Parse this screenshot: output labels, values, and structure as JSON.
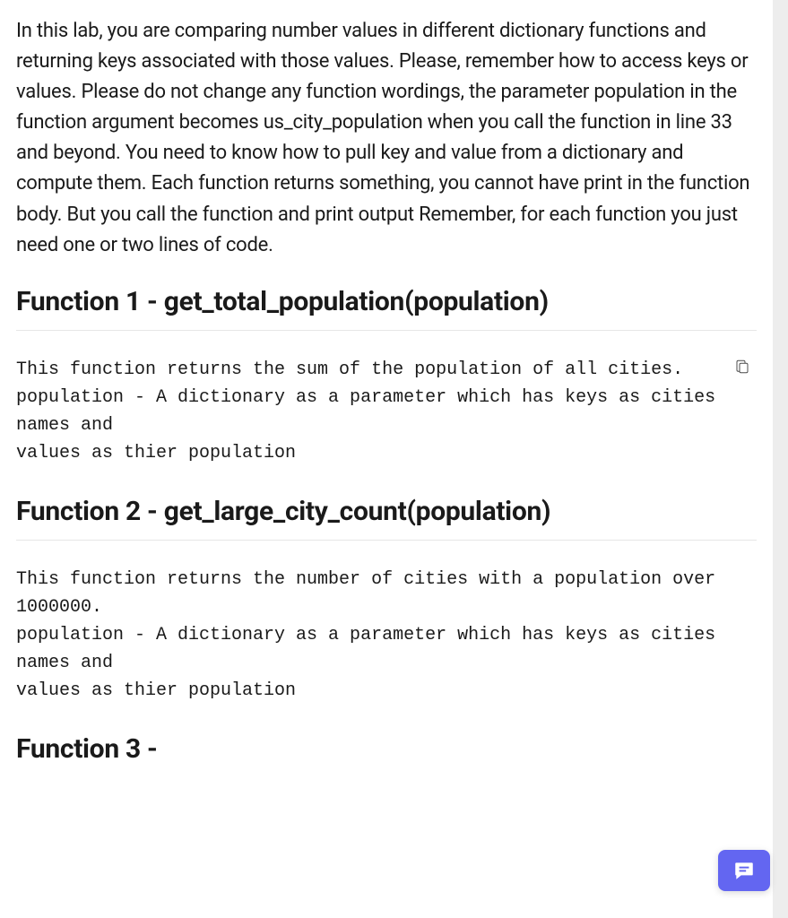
{
  "intro": "In this lab, you are comparing number values in different dictionary functions and returning keys associated with those values. Please, remember how to access keys or values. Please do not change any function wordings, the parameter population in the function argument becomes us_city_population when you call the function in line 33 and beyond. You need to know how to pull key and value from a dictionary and compute them. Each function returns something, you cannot have print in the function body. But you call the function and print output Remember, for each function you just need one or two lines of code.",
  "sections": {
    "f1": {
      "heading": "Function 1 - get_total_population(population)",
      "code": "This function returns the sum of the population of all cities.\npopulation - A dictionary as a parameter which has keys as cities names and\nvalues as thier population"
    },
    "f2": {
      "heading": "Function 2 - get_large_city_count(population)",
      "code": "This function returns the number of cities with a population over 1000000.\npopulation - A dictionary as a parameter which has keys as cities names and\nvalues as thier population"
    },
    "f3": {
      "heading": "Function 3 -"
    }
  }
}
